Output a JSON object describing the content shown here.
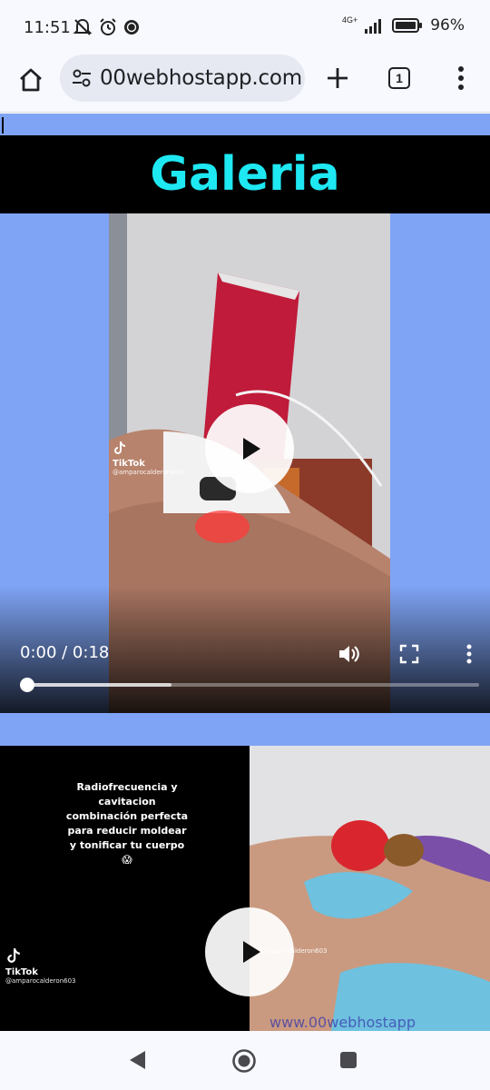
{
  "status_bar": {
    "time": "11:51",
    "network": "4G+",
    "battery": "96%"
  },
  "browser": {
    "url": "00webhostapp.com",
    "tab_count": "1"
  },
  "page": {
    "gallery_title": "Galeria",
    "video1": {
      "current_time": "0:00",
      "duration": "0:18",
      "time_display": "0:00 / 0:18",
      "buffered_fraction": 0.32,
      "played_fraction": 0.0,
      "tiktok_label": "TikTok",
      "tiktok_user": "@amparocalderon603"
    },
    "video2": {
      "caption": "Radiofrecuencia y cavitacion combinación perfecta para reducir moldear y tonificar tu cuerpo",
      "caption_emoji": "😱",
      "tiktok_label": "TikTok",
      "tiktok_user": "@amparocalderon603",
      "tiktok_user_right": "@amparocalderon603"
    }
  },
  "colors": {
    "page_bg": "#7fa4f5",
    "title_color": "#1ee8f2",
    "header_bg": "#000000"
  }
}
